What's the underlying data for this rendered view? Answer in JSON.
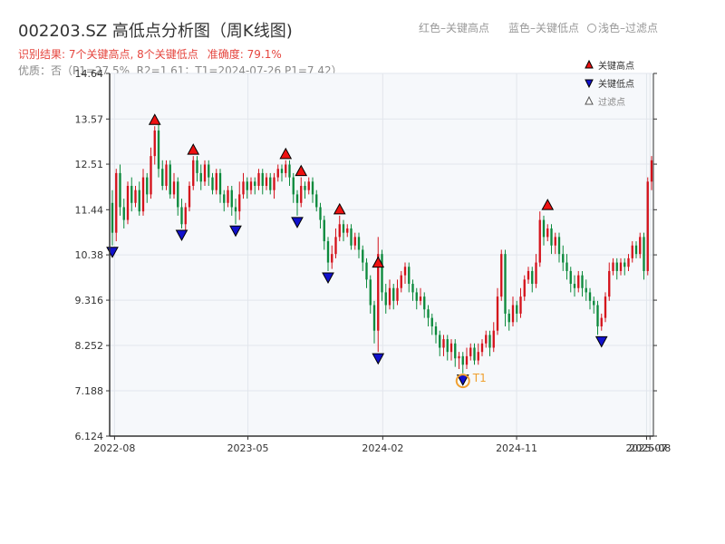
{
  "header": {
    "title": "002203.SZ 高低点分析图（周K线图)",
    "result": "识别结果: 7个关键高点, 8个关键低点",
    "accuracy": "准确度: 79.1%",
    "quality": "优质：否（P1=27.5%, R2=1.61；T1=2024-07-26 P1=7.42）",
    "legend_red": "红色–关键高点",
    "legend_blue": "蓝色–关键低点",
    "legend_light": "浅色–过滤点"
  },
  "colors": {
    "up": "#d4121b",
    "down": "#0c8a3c",
    "high_marker": "#ee1111",
    "low_marker": "#1111cc",
    "t1": "#f0a030",
    "plot_bg": "#f6f8fb",
    "grid": "#e2e6ec"
  },
  "chart_data": {
    "type": "candlestick",
    "title": "002203.SZ 高低点分析图（周K线图)",
    "ylim": [
      6.124,
      14.64
    ],
    "yticks": [
      "14.64",
      "13.57",
      "12.51",
      "11.44",
      "10.38",
      "9.316",
      "8.252",
      "7.188",
      "6.124"
    ],
    "ytick_values": [
      14.64,
      13.57,
      12.51,
      11.44,
      10.38,
      9.316,
      8.252,
      7.188,
      6.124
    ],
    "xlim": [
      "2022-07-22",
      "2025-08-08"
    ],
    "xticks": [
      {
        "label": "2022-08",
        "date": "2022-08-01"
      },
      {
        "label": "2023-05",
        "date": "2023-05-01"
      },
      {
        "label": "2024-02",
        "date": "2024-02-01"
      },
      {
        "label": "2024-11",
        "date": "2024-11-01"
      },
      {
        "label": "2025-07",
        "date": "2025-07-25"
      },
      {
        "label": "2025-08",
        "date": "2025-08-01"
      }
    ],
    "candles": [
      [
        11.6,
        10.9,
        11.9,
        10.6
      ],
      [
        10.9,
        12.3,
        12.4,
        10.7
      ],
      [
        12.3,
        11.5,
        12.5,
        11.3
      ],
      [
        11.5,
        11.2,
        11.7,
        11.0
      ],
      [
        11.2,
        12.0,
        12.1,
        11.1
      ],
      [
        12.0,
        11.6,
        12.2,
        11.4
      ],
      [
        11.6,
        11.9,
        12.0,
        11.5
      ],
      [
        11.9,
        11.4,
        12.1,
        11.3
      ],
      [
        11.4,
        12.2,
        12.4,
        11.3
      ],
      [
        12.2,
        11.8,
        12.3,
        11.6
      ],
      [
        11.8,
        12.7,
        12.9,
        11.7
      ],
      [
        12.7,
        13.3,
        13.4,
        12.5
      ],
      [
        13.3,
        12.4,
        13.5,
        12.2
      ],
      [
        12.4,
        12.0,
        12.6,
        11.9
      ],
      [
        12.0,
        12.5,
        12.6,
        11.9
      ],
      [
        12.5,
        11.8,
        12.6,
        11.7
      ],
      [
        11.8,
        12.1,
        12.3,
        11.7
      ],
      [
        12.1,
        11.5,
        12.2,
        11.3
      ],
      [
        11.5,
        11.1,
        11.7,
        11.0
      ],
      [
        11.1,
        11.5,
        11.6,
        10.95
      ],
      [
        11.5,
        12.0,
        12.1,
        11.4
      ],
      [
        12.0,
        12.6,
        12.7,
        11.9
      ],
      [
        12.6,
        12.3,
        12.7,
        12.1
      ],
      [
        12.3,
        12.1,
        12.5,
        11.9
      ],
      [
        12.1,
        12.5,
        12.6,
        12.0
      ],
      [
        12.5,
        12.2,
        12.6,
        12.0
      ],
      [
        12.2,
        11.9,
        12.3,
        11.8
      ],
      [
        11.9,
        12.3,
        12.4,
        11.8
      ],
      [
        12.3,
        11.8,
        12.4,
        11.6
      ],
      [
        11.8,
        11.6,
        11.9,
        11.4
      ],
      [
        11.6,
        11.9,
        12.0,
        11.5
      ],
      [
        11.9,
        11.5,
        12.0,
        11.3
      ],
      [
        11.5,
        11.4,
        11.7,
        11.1
      ],
      [
        11.4,
        11.8,
        12.1,
        11.2
      ],
      [
        11.8,
        12.1,
        12.3,
        11.7
      ],
      [
        12.1,
        11.9,
        12.2,
        11.7
      ],
      [
        11.9,
        12.1,
        12.2,
        11.8
      ],
      [
        12.1,
        12.0,
        12.2,
        11.8
      ],
      [
        12.0,
        12.3,
        12.4,
        11.9
      ],
      [
        12.3,
        12.0,
        12.4,
        11.8
      ],
      [
        12.0,
        12.2,
        12.3,
        11.9
      ],
      [
        12.2,
        11.9,
        12.3,
        11.8
      ],
      [
        11.9,
        12.2,
        12.3,
        11.7
      ],
      [
        12.2,
        12.4,
        12.5,
        12.1
      ],
      [
        12.4,
        12.3,
        12.5,
        12.1
      ],
      [
        12.3,
        12.5,
        12.6,
        12.2
      ],
      [
        12.5,
        12.2,
        12.6,
        12.0
      ],
      [
        12.2,
        11.8,
        12.3,
        11.6
      ],
      [
        11.8,
        11.6,
        11.9,
        11.3
      ],
      [
        11.6,
        12.0,
        12.2,
        11.5
      ],
      [
        12.0,
        11.9,
        12.1,
        11.7
      ],
      [
        11.9,
        12.1,
        12.2,
        11.8
      ],
      [
        12.1,
        11.8,
        12.2,
        11.6
      ],
      [
        11.8,
        11.5,
        11.9,
        11.4
      ],
      [
        11.5,
        11.2,
        11.6,
        11.0
      ],
      [
        11.2,
        10.7,
        11.3,
        10.5
      ],
      [
        10.7,
        10.2,
        10.8,
        10.0
      ],
      [
        10.2,
        10.4,
        10.6,
        10.05
      ],
      [
        10.4,
        10.8,
        11.0,
        10.3
      ],
      [
        10.8,
        11.1,
        11.3,
        10.7
      ],
      [
        11.1,
        10.9,
        11.2,
        10.7
      ],
      [
        10.9,
        11.0,
        11.1,
        10.8
      ],
      [
        11.0,
        10.6,
        11.1,
        10.5
      ],
      [
        10.6,
        10.8,
        10.9,
        10.5
      ],
      [
        10.8,
        10.5,
        10.9,
        10.3
      ],
      [
        10.5,
        10.2,
        10.6,
        10.0
      ],
      [
        10.2,
        9.8,
        10.3,
        9.6
      ],
      [
        9.8,
        9.2,
        9.9,
        9.0
      ],
      [
        9.2,
        8.6,
        9.3,
        8.3
      ],
      [
        8.6,
        10.4,
        10.8,
        8.1
      ],
      [
        10.4,
        9.5,
        10.5,
        9.3
      ],
      [
        9.5,
        9.2,
        9.7,
        9.0
      ],
      [
        9.2,
        9.6,
        9.8,
        9.1
      ],
      [
        9.6,
        9.3,
        9.7,
        9.1
      ],
      [
        9.3,
        9.6,
        9.8,
        9.2
      ],
      [
        9.6,
        9.9,
        10.0,
        9.5
      ],
      [
        9.9,
        10.1,
        10.2,
        9.7
      ],
      [
        10.1,
        9.7,
        10.2,
        9.5
      ],
      [
        9.7,
        9.5,
        9.8,
        9.3
      ],
      [
        9.5,
        9.3,
        9.6,
        9.1
      ],
      [
        9.3,
        9.4,
        9.6,
        9.2
      ],
      [
        9.4,
        9.1,
        9.5,
        8.9
      ],
      [
        9.1,
        8.9,
        9.2,
        8.7
      ],
      [
        8.9,
        8.7,
        9.0,
        8.5
      ],
      [
        8.7,
        8.5,
        8.8,
        8.3
      ],
      [
        8.5,
        8.2,
        8.6,
        8.0
      ],
      [
        8.2,
        8.4,
        8.5,
        8.0
      ],
      [
        8.4,
        8.1,
        8.5,
        7.9
      ],
      [
        8.1,
        8.3,
        8.4,
        7.9
      ],
      [
        8.3,
        7.95,
        8.4,
        7.75
      ],
      [
        7.95,
        8.0,
        8.1,
        7.7
      ],
      [
        8.0,
        7.8,
        8.1,
        7.6
      ],
      [
        7.8,
        8.0,
        8.2,
        7.7
      ],
      [
        8.0,
        8.2,
        8.3,
        7.9
      ],
      [
        8.2,
        7.9,
        8.3,
        7.8
      ],
      [
        7.9,
        8.1,
        8.3,
        7.8
      ],
      [
        8.1,
        8.3,
        8.4,
        8.0
      ],
      [
        8.3,
        8.5,
        8.6,
        8.2
      ],
      [
        8.5,
        8.2,
        8.6,
        8.0
      ],
      [
        8.2,
        8.6,
        8.8,
        8.1
      ],
      [
        8.6,
        9.4,
        9.6,
        8.5
      ],
      [
        9.4,
        10.4,
        10.5,
        9.3
      ],
      [
        10.4,
        9.0,
        10.5,
        8.7
      ],
      [
        9.0,
        8.8,
        9.1,
        8.6
      ],
      [
        8.8,
        9.2,
        9.4,
        8.7
      ],
      [
        9.2,
        9.0,
        9.3,
        8.8
      ],
      [
        9.0,
        9.4,
        9.6,
        8.9
      ],
      [
        9.4,
        9.8,
        9.9,
        9.3
      ],
      [
        9.8,
        10.0,
        10.1,
        9.7
      ],
      [
        10.0,
        9.7,
        10.1,
        9.5
      ],
      [
        9.7,
        10.2,
        10.4,
        9.6
      ],
      [
        10.2,
        11.2,
        11.4,
        10.1
      ],
      [
        11.2,
        10.8,
        11.3,
        10.6
      ],
      [
        10.8,
        11.0,
        11.1,
        10.7
      ],
      [
        11.0,
        10.6,
        11.1,
        10.4
      ],
      [
        10.6,
        10.8,
        10.9,
        10.4
      ],
      [
        10.8,
        10.4,
        10.9,
        10.2
      ],
      [
        10.4,
        10.2,
        10.6,
        10.0
      ],
      [
        10.2,
        10.0,
        10.4,
        9.8
      ],
      [
        10.0,
        9.7,
        10.1,
        9.5
      ],
      [
        9.7,
        9.6,
        9.9,
        9.4
      ],
      [
        9.6,
        9.9,
        10.0,
        9.5
      ],
      [
        9.9,
        9.6,
        10.0,
        9.4
      ],
      [
        9.6,
        9.5,
        9.8,
        9.3
      ],
      [
        9.5,
        9.3,
        9.6,
        9.1
      ],
      [
        9.3,
        9.2,
        9.4,
        9.0
      ],
      [
        9.2,
        8.7,
        9.3,
        8.5
      ],
      [
        8.7,
        8.9,
        9.0,
        8.6
      ],
      [
        8.9,
        9.4,
        9.5,
        8.8
      ],
      [
        9.4,
        10.0,
        10.2,
        9.3
      ],
      [
        10.0,
        10.2,
        10.3,
        9.9
      ],
      [
        10.2,
        10.0,
        10.3,
        9.8
      ],
      [
        10.0,
        10.2,
        10.3,
        9.9
      ],
      [
        10.2,
        10.1,
        10.3,
        9.9
      ],
      [
        10.1,
        10.3,
        10.4,
        10.0
      ],
      [
        10.3,
        10.6,
        10.7,
        10.2
      ],
      [
        10.6,
        10.4,
        10.7,
        10.3
      ],
      [
        10.4,
        10.8,
        10.9,
        10.3
      ],
      [
        10.8,
        10.0,
        10.9,
        9.8
      ],
      [
        10.0,
        12.1,
        12.2,
        9.9
      ],
      [
        12.1,
        12.6,
        12.7,
        11.9
      ]
    ],
    "key_highs": [
      {
        "index": 11,
        "price": 13.4
      },
      {
        "index": 21,
        "price": 12.7
      },
      {
        "index": 45,
        "price": 12.6
      },
      {
        "index": 49,
        "price": 12.2
      },
      {
        "index": 59,
        "price": 11.3
      },
      {
        "index": 69,
        "price": 10.05
      },
      {
        "index": 113,
        "price": 11.4
      }
    ],
    "key_lows": [
      {
        "index": 0,
        "price": 10.6
      },
      {
        "index": 18,
        "price": 11.0
      },
      {
        "index": 32,
        "price": 11.1
      },
      {
        "index": 48,
        "price": 11.3
      },
      {
        "index": 56,
        "price": 10.0
      },
      {
        "index": 69,
        "price": 8.1
      },
      {
        "index": 91,
        "price": 7.6
      },
      {
        "index": 127,
        "price": 8.5
      }
    ],
    "t1": {
      "index": 91,
      "price": 7.42,
      "label": "T1"
    },
    "legend": {
      "position": "top-right",
      "items": [
        {
          "label": "关键高点",
          "kind": "high"
        },
        {
          "label": "关键低点",
          "kind": "low"
        },
        {
          "label": "过滤点",
          "kind": "filtered"
        }
      ]
    },
    "grid": true
  }
}
